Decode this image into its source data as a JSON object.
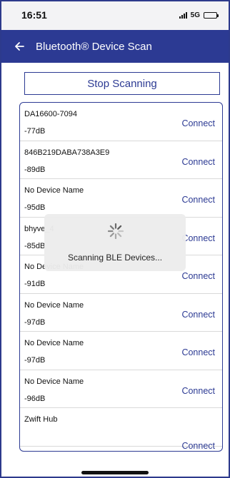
{
  "status_bar": {
    "time": "16:51",
    "network": "5G"
  },
  "app_bar": {
    "title": "Bluetooth® Device Scan",
    "back_icon": "arrow-left-icon"
  },
  "actions": {
    "stop_label": "Stop Scanning"
  },
  "devices": [
    {
      "name": "DA16600-7094",
      "rssi": "-77dB",
      "action": "Connect"
    },
    {
      "name": "846B219DABA738A3E9",
      "rssi": "-89dB",
      "action": "Connect"
    },
    {
      "name": "No Device Name",
      "rssi": "-95dB",
      "action": "Connect"
    },
    {
      "name": "bhyve_4",
      "rssi": "-85dB",
      "action": "Connect"
    },
    {
      "name": "No Device Name",
      "rssi": "-91dB",
      "action": "Connect"
    },
    {
      "name": "No Device Name",
      "rssi": "-97dB",
      "action": "Connect"
    },
    {
      "name": "No Device Name",
      "rssi": "-97dB",
      "action": "Connect"
    },
    {
      "name": "No Device Name",
      "rssi": "-96dB",
      "action": "Connect"
    },
    {
      "name": "Zwift Hub",
      "rssi": "",
      "action": "Connect"
    }
  ],
  "overlay": {
    "message": "Scanning BLE Devices...",
    "icon": "spinner-icon"
  },
  "colors": {
    "primary": "#2c3a93",
    "status_bar_bg": "#f3f3f5"
  }
}
